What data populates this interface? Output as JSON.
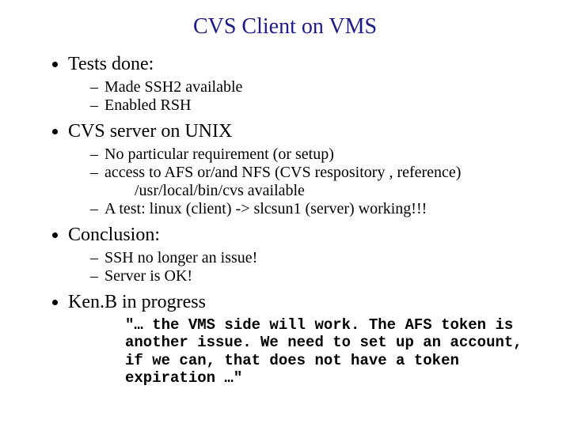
{
  "title": "CVS Client on VMS",
  "bullets": {
    "b1": "Tests done:",
    "b1s1": "Made SSH2 available",
    "b1s2": "Enabled RSH",
    "b2": "CVS server on UNIX",
    "b2s1": "No particular requirement (or setup)",
    "b2s2a": "access to AFS or/and NFS  (CVS respository ,  reference)",
    "b2s2b": "/usr/local/bin/cvs available",
    "b2s3": "A test: linux (client) -> slcsun1 (server) working!!!",
    "b3": "Conclusion:",
    "b3s1": "SSH no longer an issue!",
    "b3s2": "Server is OK!",
    "b4": "Ken.B in progress",
    "quote": "\"… the VMS side will work. The AFS token is another issue.  We need to set up an account, if we can, that does not have a token expiration …\""
  }
}
